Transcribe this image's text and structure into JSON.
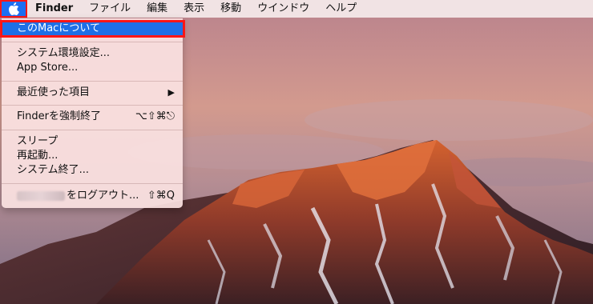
{
  "menubar": {
    "apple_icon": "apple-icon",
    "app_name": "Finder",
    "items": [
      "ファイル",
      "編集",
      "表示",
      "移動",
      "ウインドウ",
      "ヘルプ"
    ]
  },
  "apple_menu": {
    "about": "このMacについて",
    "system_prefs": "システム環境設定...",
    "app_store": "App Store...",
    "recent_items": "最近使った項目",
    "recent_arrow": "▶",
    "force_quit": "Finderを強制終了",
    "force_quit_shortcut": "⌥⇧⌘⎋",
    "sleep": "スリープ",
    "restart": "再起動...",
    "shutdown": "システム終了...",
    "logout_suffix": "をログアウト...",
    "logout_shortcut": "⇧⌘Q"
  },
  "colors": {
    "highlight": "#1e6fe6",
    "annotation_frame": "#ff1616",
    "menu_bg": "#fae1e1"
  }
}
